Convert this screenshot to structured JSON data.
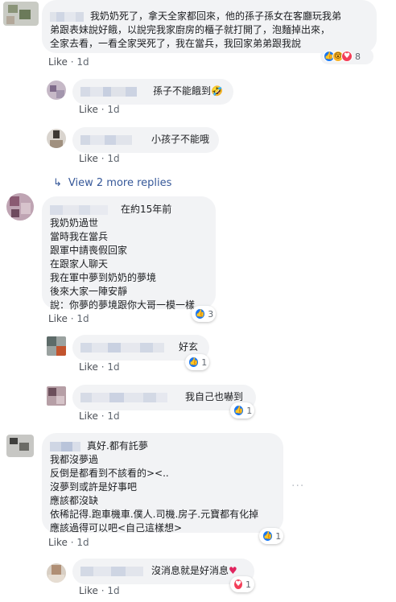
{
  "thread": {
    "c1": {
      "lines": [
        "我奶奶死了，拿天全家都回來，他的孫子孫女在客廳玩我弟",
        "弟跟表妹說好餓，以說完我家廚房的櫃子就打開了，泡麵掉出來，",
        "全家去看，一看全家哭死了，我在當兵，我回家弟弟跟我說"
      ],
      "like": "Like",
      "time": "1d",
      "reaction_count": "8"
    },
    "r1": {
      "text": "孫子不能餓到🤣",
      "like": "Like",
      "time": "1d"
    },
    "r2": {
      "text": "小孩子不能哦",
      "like": "Like",
      "time": "1d"
    },
    "view_more": "View 2 more replies",
    "c2": {
      "head": "在約15年前",
      "lines": [
        "我奶奶過世",
        "當時我在當兵",
        "跟軍中請喪假回家",
        "在跟家人聊天",
        "我在軍中夢到奶奶的夢境",
        "後來大家一陣安靜",
        "說：你夢的夢境跟你大哥一模一樣"
      ],
      "like": "Like",
      "time": "1d",
      "reaction_count": "3"
    },
    "r3": {
      "text": "好玄",
      "like": "Like",
      "time": "1d",
      "reaction_count": "1"
    },
    "r4": {
      "text": "我自己也嚇到",
      "like": "Like",
      "time": "1d",
      "reaction_count": "1"
    },
    "c3": {
      "head": "真好.都有託夢",
      "lines": [
        "我都沒夢過",
        "反倒是都看到不該看的><..",
        "沒夢到或許是好事吧",
        "應該都沒缺",
        "依稀記得.跑車機車.僕人.司機.房子.元寶都有化掉",
        "應該過得可以吧<自己這樣想>"
      ],
      "like": "Like",
      "time": "1d",
      "reaction_count": "1",
      "dots": "···"
    },
    "r5": {
      "text": "沒消息就是好消息",
      "like": "Like",
      "time": "1d",
      "reaction_count": "1"
    }
  },
  "colors": {
    "bubble": "#f2f3f5",
    "link": "#365899",
    "like_blue": "#1877f2",
    "meta": "#606770"
  }
}
